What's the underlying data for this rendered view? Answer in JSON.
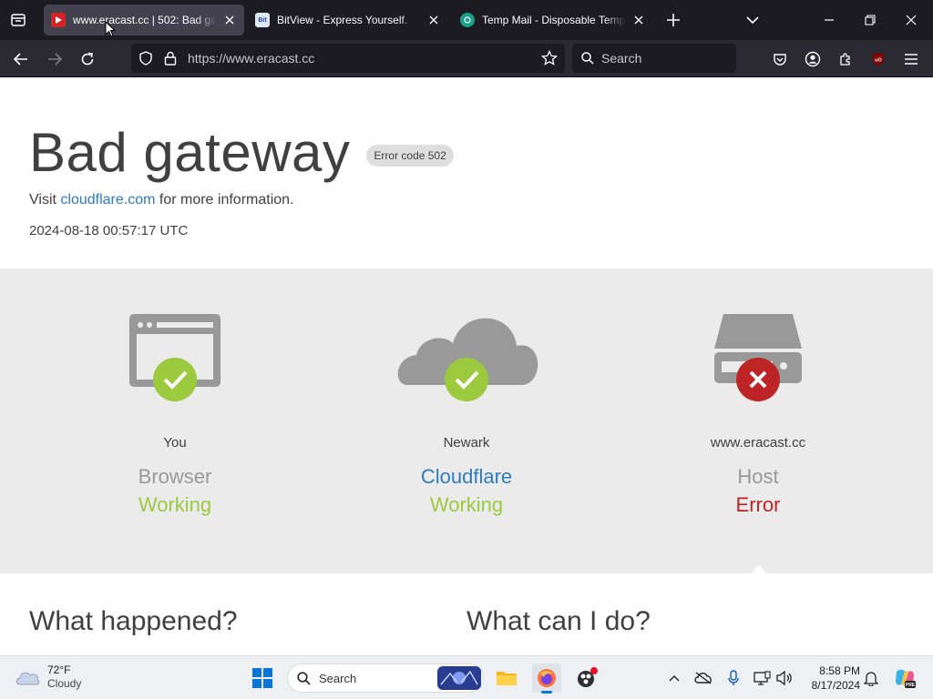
{
  "browser": {
    "tabs": [
      {
        "title": "www.eracast.cc | 502: Bad gateway",
        "active": true
      },
      {
        "title": "BitView - Express Yourself.",
        "active": false
      },
      {
        "title": "Temp Mail - Disposable Temporary Email",
        "active": false
      }
    ],
    "url": "https://www.eracast.cc",
    "search_placeholder": "Search"
  },
  "error_page": {
    "title": "Bad gateway",
    "badge": "Error code 502",
    "visit_prefix": "Visit ",
    "visit_link": "cloudflare.com",
    "visit_suffix": " for more information.",
    "timestamp": "2024-08-18 00:57:17 UTC",
    "nodes": [
      {
        "location": "You",
        "kind": "Browser",
        "status": "Working",
        "icon": "browser-icon"
      },
      {
        "location": "Newark",
        "kind": "Cloudflare",
        "status": "Working",
        "icon": "cloud-icon"
      },
      {
        "location": "www.eracast.cc",
        "kind": "Host",
        "status": "Error",
        "icon": "server-icon"
      }
    ],
    "what_happened": "What happened?",
    "what_can_i_do": "What can I do?"
  },
  "colors": {
    "working": "#9bca3e",
    "error": "#bd2426",
    "link": "#2f7bbf"
  },
  "taskbar": {
    "weather_temp": "72°F",
    "weather_cond": "Cloudy",
    "search_placeholder": "Search",
    "time": "8:58 PM",
    "date": "8/17/2024"
  }
}
